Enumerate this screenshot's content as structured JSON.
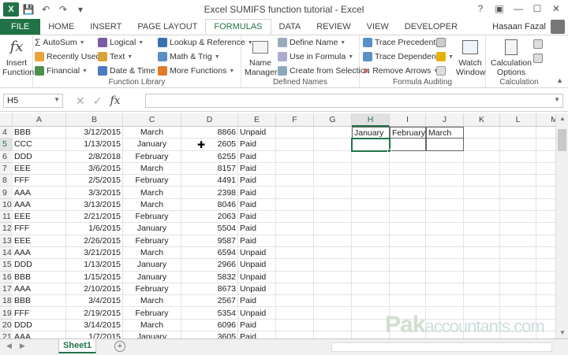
{
  "window": {
    "title": "Excel SUMIFS function tutorial - Excel",
    "user": "Hasaan Fazal",
    "help": "?"
  },
  "tabs": [
    "FILE",
    "HOME",
    "INSERT",
    "PAGE LAYOUT",
    "FORMULAS",
    "DATA",
    "REVIEW",
    "VIEW",
    "DEVELOPER"
  ],
  "active_tab": "FORMULAS",
  "ribbon": {
    "insert_function": [
      "Insert",
      "Function"
    ],
    "function_library": {
      "label": "Function Library",
      "autosum": "AutoSum",
      "recently_used": "Recently Used",
      "financial": "Financial",
      "logical": "Logical",
      "text": "Text",
      "date_time": "Date & Time",
      "lookup": "Lookup & Reference",
      "math": "Math & Trig",
      "more": "More Functions"
    },
    "defined_names": {
      "label": "Defined Names",
      "name_manager": [
        "Name",
        "Manager"
      ],
      "define_name": "Define Name",
      "use_in_formula": "Use in Formula",
      "create_from_selection": "Create from Selection"
    },
    "formula_auditing": {
      "label": "Formula Auditing",
      "trace_precedents": "Trace Precedents",
      "trace_dependents": "Trace Dependents",
      "remove_arrows": "Remove Arrows",
      "watch_window": [
        "Watch",
        "Window"
      ]
    },
    "calculation": {
      "label": "Calculation",
      "calc_options": [
        "Calculation",
        "Options"
      ]
    }
  },
  "formula_bar": {
    "name_box": "H5",
    "fx": "fx",
    "formula": ""
  },
  "columns": [
    "A",
    "B",
    "C",
    "D",
    "E",
    "F",
    "G",
    "H",
    "I",
    "J",
    "K",
    "L",
    "M"
  ],
  "selected_column": "H",
  "rows": [
    {
      "n": "4",
      "a": "BBB",
      "b": "3/12/2015",
      "c": "March",
      "d": "8866",
      "e": "Unpaid"
    },
    {
      "n": "5",
      "a": "CCC",
      "b": "1/13/2015",
      "c": "January",
      "d": "2605",
      "e": "Paid"
    },
    {
      "n": "6",
      "a": "DDD",
      "b": "2/8/2018",
      "c": "February",
      "d": "6255",
      "e": "Paid"
    },
    {
      "n": "7",
      "a": "EEE",
      "b": "3/6/2015",
      "c": "March",
      "d": "8157",
      "e": "Paid"
    },
    {
      "n": "8",
      "a": "FFF",
      "b": "2/5/2015",
      "c": "February",
      "d": "4491",
      "e": "Paid"
    },
    {
      "n": "9",
      "a": "AAA",
      "b": "3/3/2015",
      "c": "March",
      "d": "2398",
      "e": "Paid"
    },
    {
      "n": "10",
      "a": "AAA",
      "b": "3/13/2015",
      "c": "March",
      "d": "8046",
      "e": "Paid"
    },
    {
      "n": "11",
      "a": "EEE",
      "b": "2/21/2015",
      "c": "February",
      "d": "2063",
      "e": "Paid"
    },
    {
      "n": "12",
      "a": "FFF",
      "b": "1/6/2015",
      "c": "January",
      "d": "5504",
      "e": "Paid"
    },
    {
      "n": "13",
      "a": "EEE",
      "b": "2/26/2015",
      "c": "February",
      "d": "9587",
      "e": "Paid"
    },
    {
      "n": "14",
      "a": "AAA",
      "b": "3/21/2015",
      "c": "March",
      "d": "6594",
      "e": "Unpaid"
    },
    {
      "n": "15",
      "a": "DDD",
      "b": "1/13/2015",
      "c": "January",
      "d": "2966",
      "e": "Unpaid"
    },
    {
      "n": "16",
      "a": "BBB",
      "b": "1/15/2015",
      "c": "January",
      "d": "5832",
      "e": "Unpaid"
    },
    {
      "n": "17",
      "a": "AAA",
      "b": "2/10/2015",
      "c": "February",
      "d": "8673",
      "e": "Unpaid"
    },
    {
      "n": "18",
      "a": "BBB",
      "b": "3/4/2015",
      "c": "March",
      "d": "2567",
      "e": "Paid"
    },
    {
      "n": "19",
      "a": "FFF",
      "b": "2/19/2015",
      "c": "February",
      "d": "5354",
      "e": "Unpaid"
    },
    {
      "n": "20",
      "a": "DDD",
      "b": "3/14/2015",
      "c": "March",
      "d": "6096",
      "e": "Paid"
    },
    {
      "n": "21",
      "a": "AAA",
      "b": "1/7/2015",
      "c": "January",
      "d": "3605",
      "e": "Paid"
    }
  ],
  "summary_headers": {
    "h": "January",
    "i": "February",
    "j": "March"
  },
  "sheet": {
    "name": "Sheet1",
    "add": "+"
  },
  "watermark": {
    "big": "Pak",
    "small": "accountants.com"
  },
  "colors": {
    "accent": "#217346"
  }
}
